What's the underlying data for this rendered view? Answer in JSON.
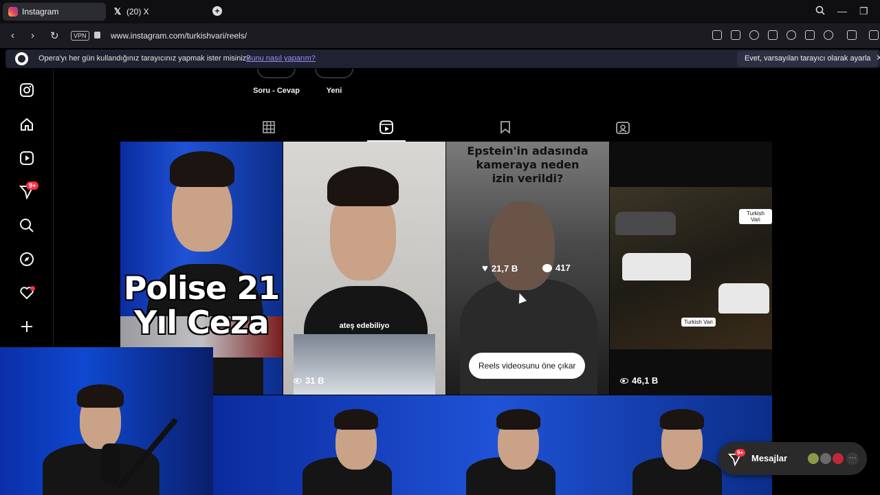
{
  "browser": {
    "tabs": [
      {
        "label": "Instagram",
        "active": true
      },
      {
        "label": "(20) X",
        "active": false
      }
    ],
    "url": "www.instagram.com/turkishvari/reels/",
    "vpn_label": "VPN"
  },
  "infobar": {
    "message": "Opera'yı her gün kullandığınız tarayıcınız yapmak ister misiniz?",
    "link": "Bunu nasıl yaparım?",
    "button": "Evet, varsayılan tarayıcı olarak ayarla"
  },
  "sidebar": {
    "items": [
      "instagram-logo",
      "home",
      "reels",
      "messages",
      "search",
      "explore",
      "notifications",
      "create"
    ],
    "messages_badge": "9+"
  },
  "highlights": [
    {
      "label": "Soru - Cevap"
    },
    {
      "label": "Yeni"
    }
  ],
  "profile_tabs": [
    "posts",
    "reels",
    "saved",
    "tagged"
  ],
  "reels": [
    {
      "overlay_text_line1": "Polise 21",
      "overlay_text_line2": "Yıl Ceza",
      "views": ""
    },
    {
      "caption": "ateş edebiliyo",
      "views": "31 B"
    },
    {
      "top_caption": "Epstein'in adasında kameraya neden izin verildi?",
      "likes": "21,7 B",
      "comments": "417",
      "tooltip": "Reels videosunu öne çıkar"
    },
    {
      "watermark": "Turkish Vari",
      "views": "46,1 B"
    }
  ],
  "messages_pill": {
    "label": "Mesajlar",
    "badge": "9+"
  },
  "colors": {
    "accent_red": "#ff3040",
    "link_purple": "#9d8cff",
    "bg": "#000000"
  }
}
